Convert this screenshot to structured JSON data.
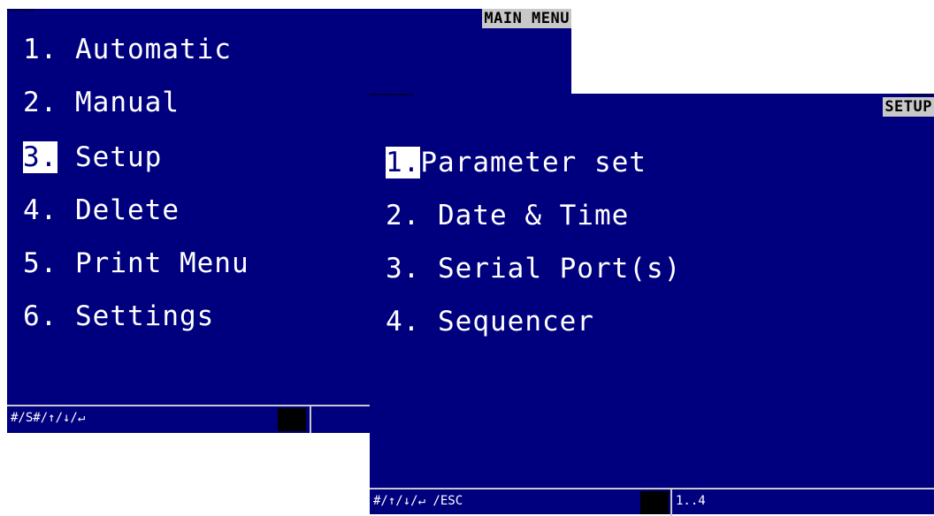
{
  "main_menu": {
    "title": "MAIN MENU",
    "items": [
      {
        "num": "1.",
        "label": "Automatic"
      },
      {
        "num": "2.",
        "label": "Manual"
      },
      {
        "num": "3.",
        "label": "Setup"
      },
      {
        "num": "4.",
        "label": "Delete"
      },
      {
        "num": "5.",
        "label": "Print Menu"
      },
      {
        "num": "6.",
        "label": "Settings"
      }
    ],
    "selected_index": 2,
    "status_keys": "#/S#/↑/↓/↵"
  },
  "setup_menu": {
    "title": "SETUP",
    "items": [
      {
        "num": "1.",
        "label": "Parameter set"
      },
      {
        "num": "2.",
        "label": "Date & Time"
      },
      {
        "num": "3.",
        "label": "Serial Port(s)"
      },
      {
        "num": "4.",
        "label": "Sequencer"
      }
    ],
    "selected_index": 0,
    "status_keys": "#/↑/↓/↵ /ESC",
    "status_range": "1..4"
  },
  "colors": {
    "screen_bg": "#00007f",
    "title_bg": "#c8c8c8",
    "text": "#ffffff"
  }
}
